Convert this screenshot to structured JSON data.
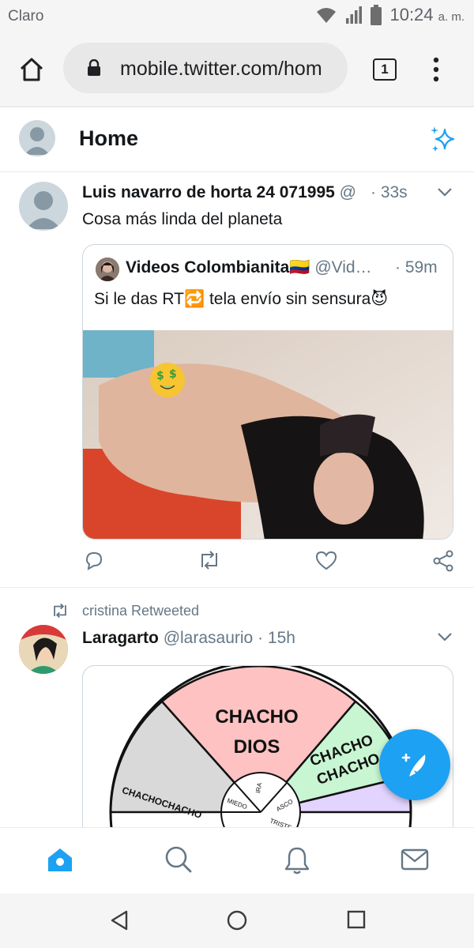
{
  "status_bar": {
    "carrier": "Claro",
    "time": "10:24",
    "ampm": "a. m."
  },
  "browser": {
    "url": "mobile.twitter.com/hom",
    "tab_count": "1"
  },
  "header": {
    "title": "Home"
  },
  "tweets": [
    {
      "author_name": "Luis navarro de horta 24 071995",
      "author_handle": "@",
      "time": "· 33s",
      "text": "Cosa más linda del planeta",
      "quote": {
        "author_name": "Videos Colombianita🇨🇴",
        "author_handle": "@Vid…",
        "time": "· 59m",
        "text": "Si le das RT🔁 tela envío sin sensura😈"
      }
    },
    {
      "retweet_note": "cristina Retweeted",
      "author_name": "Laragarto",
      "author_handle": "@larasaurio",
      "time": "· 15h",
      "wheel": {
        "top": [
          "CHACHO",
          "DIOS"
        ],
        "left": "CHACHOCHACHO",
        "right": [
          "CHACHO",
          "CHACHO"
        ],
        "inner": [
          "IRA",
          "MIEDO",
          "ASCO",
          "TRISTE"
        ]
      }
    }
  ],
  "colors": {
    "accent": "#1da1f2",
    "secondary_text": "#657786",
    "border": "#ccd6dd"
  },
  "icons": [
    "home-icon",
    "lock-icon",
    "tab-switcher-icon",
    "more-vert-icon",
    "sparkle-icon",
    "chevron-down-icon",
    "reply-icon",
    "retweet-icon",
    "like-icon",
    "share-icon",
    "compose-icon",
    "search-icon",
    "notifications-icon",
    "messages-icon",
    "android-back-icon",
    "android-home-icon",
    "android-recents-icon"
  ]
}
